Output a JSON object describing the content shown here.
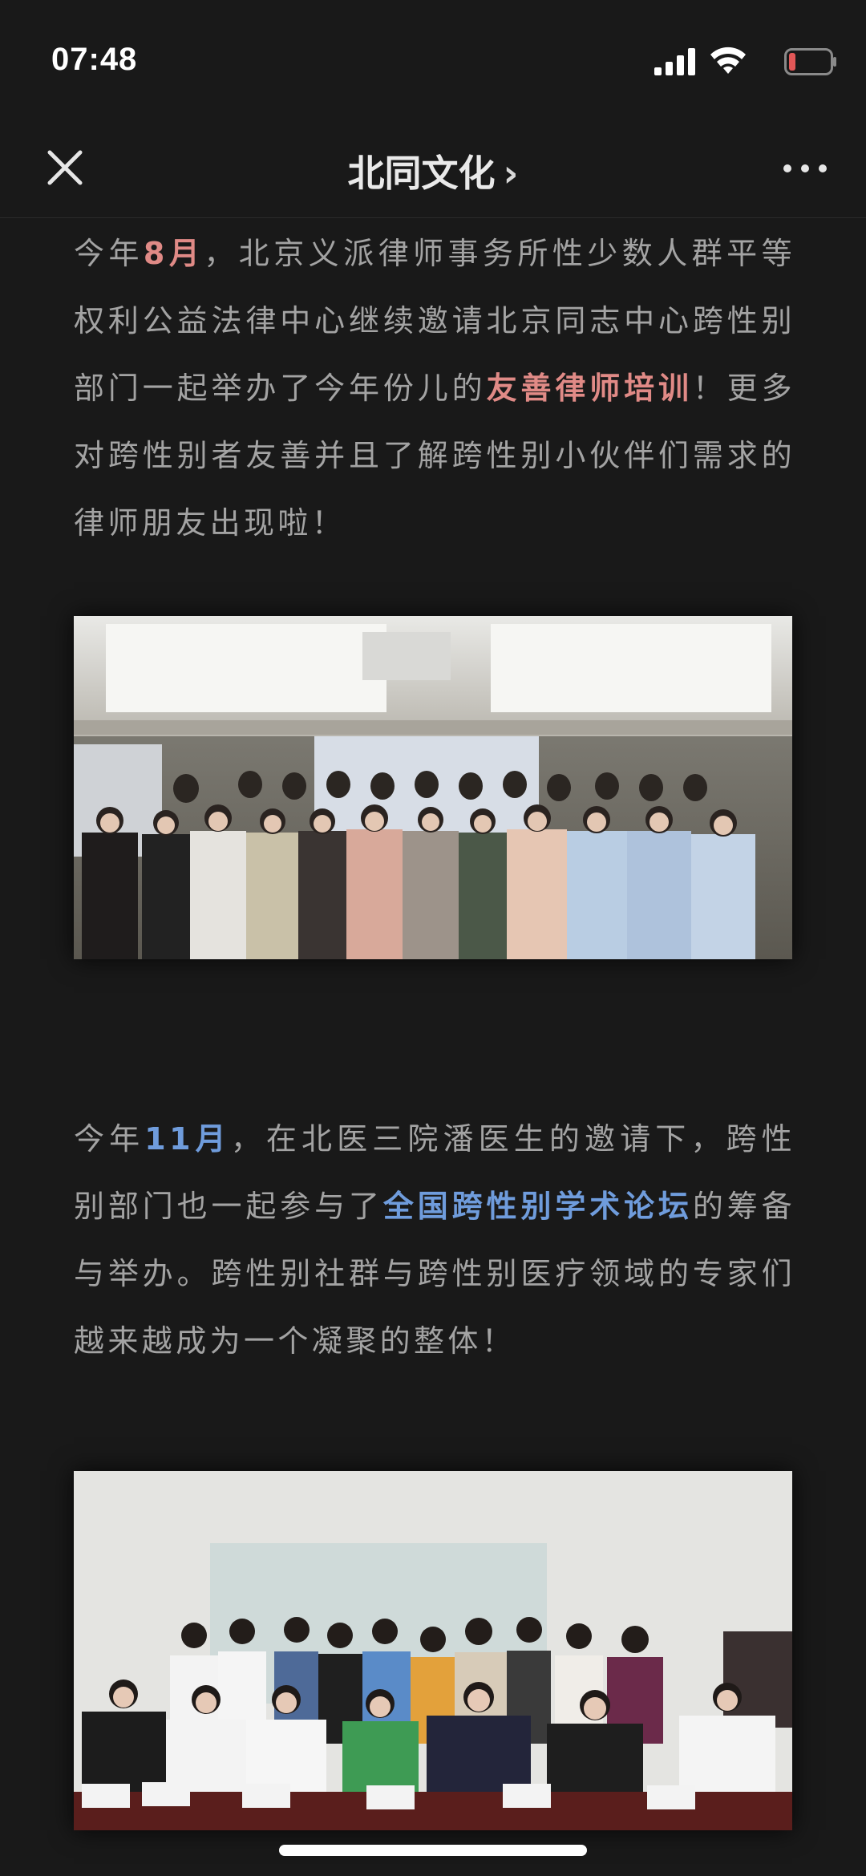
{
  "status_bar": {
    "time": "07:48",
    "icons": [
      "signal-icon",
      "wifi-icon",
      "battery-low-icon"
    ],
    "battery_color": "#e25757"
  },
  "nav": {
    "title": "北同文化",
    "chevron": "›",
    "left_icon": "close-icon",
    "right_icon": "more-icon"
  },
  "article": {
    "paragraph1": {
      "t1": "今年",
      "h1": "8月",
      "t2": "，北京义派律师事务所性少数人群平等权利公益法律中心继续邀请北京同志中心跨性别部门一起举办了今年份儿的",
      "h2": "友善律师培训",
      "t3": "！更多对跨性别者友善并且了解跨性别小伙伴们需求的律师朋友出现啦！"
    },
    "photo1": {
      "semantic": "group-photo-lawyer-training"
    },
    "paragraph2": {
      "t1": "今年",
      "h1": "11月",
      "t2": "，在北医三院潘医生的邀请下，跨性别部门也一起参与了",
      "h2": "全国跨性别学术论坛",
      "t3": "的筹备与举办。跨性别社群与跨性别医疗领域的专家们越来越成为一个凝聚的整体！"
    },
    "photo2": {
      "semantic": "group-photo-transgender-forum"
    }
  },
  "colors": {
    "background": "#191919",
    "body_text": "#a3a3a3",
    "highlight_red": "#e08a86",
    "highlight_blue": "#6f9cdc"
  }
}
